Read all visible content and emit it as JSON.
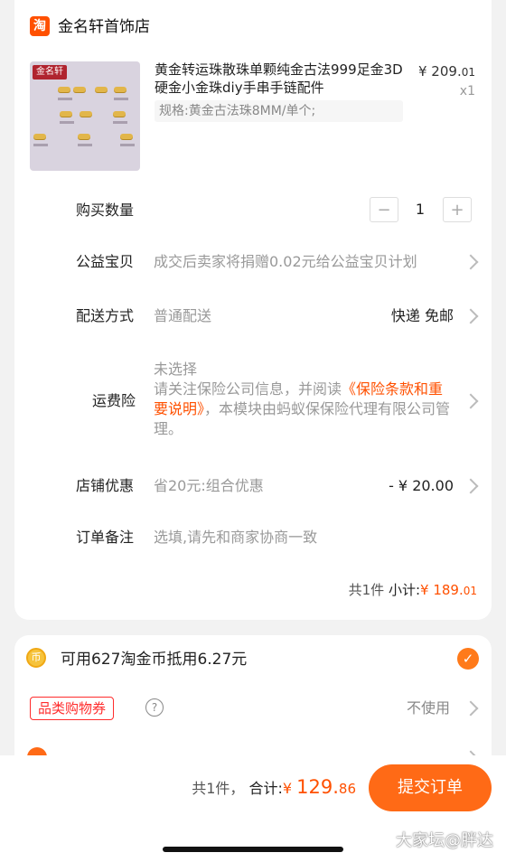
{
  "shop": {
    "logo_char": "淘",
    "name": "金名轩首饰店"
  },
  "product": {
    "thumb_brand": "金名轩",
    "title": "黄金转运珠散珠单颗纯金古法999足金3D硬金小金珠diy手串手链配件",
    "spec": "规格:黄金古法珠8MM/单个;",
    "price_int": "¥ 209.",
    "price_dec": "01",
    "qty": "x1"
  },
  "quantity": {
    "label": "购买数量",
    "value": "1",
    "minus": "−",
    "plus": "+"
  },
  "charity": {
    "label": "公益宝贝",
    "text": "成交后卖家将捐赠0.02元给公益宝贝计划"
  },
  "delivery": {
    "label": "配送方式",
    "value": "普通配送",
    "option": "快递 免邮"
  },
  "insurance": {
    "label": "运费险",
    "status": "未选择",
    "text_prefix": "请关注保险公司信息，并阅读",
    "link": "《保险条款和重要说明》",
    "text_suffix": "，本模块由蚂蚁保保险代理有限公司管理。"
  },
  "store_discount": {
    "label": "店铺优惠",
    "text": "省20元:组合优惠",
    "amount": "- ¥ 20.00"
  },
  "note": {
    "label": "订单备注",
    "placeholder": "选填,请先和商家协商一致"
  },
  "subtotal": {
    "count": "共1件",
    "label": "小计:",
    "currency": "¥ ",
    "int": "189.",
    "dec": "01"
  },
  "coins": {
    "text": "可用627淘金币抵用6.27元",
    "checked": true
  },
  "coupon": {
    "label": "品类购物券",
    "value": "不使用"
  },
  "footer": {
    "count": "共1件，",
    "total_label": "合计:",
    "currency": "¥ ",
    "int": "129.",
    "dec": "86",
    "submit": "提交订单"
  },
  "watermark": "大家坛@胖达",
  "colors": {
    "accent": "#ff5000",
    "button": "#ff6a16",
    "coupon": "#ff2c2c"
  }
}
